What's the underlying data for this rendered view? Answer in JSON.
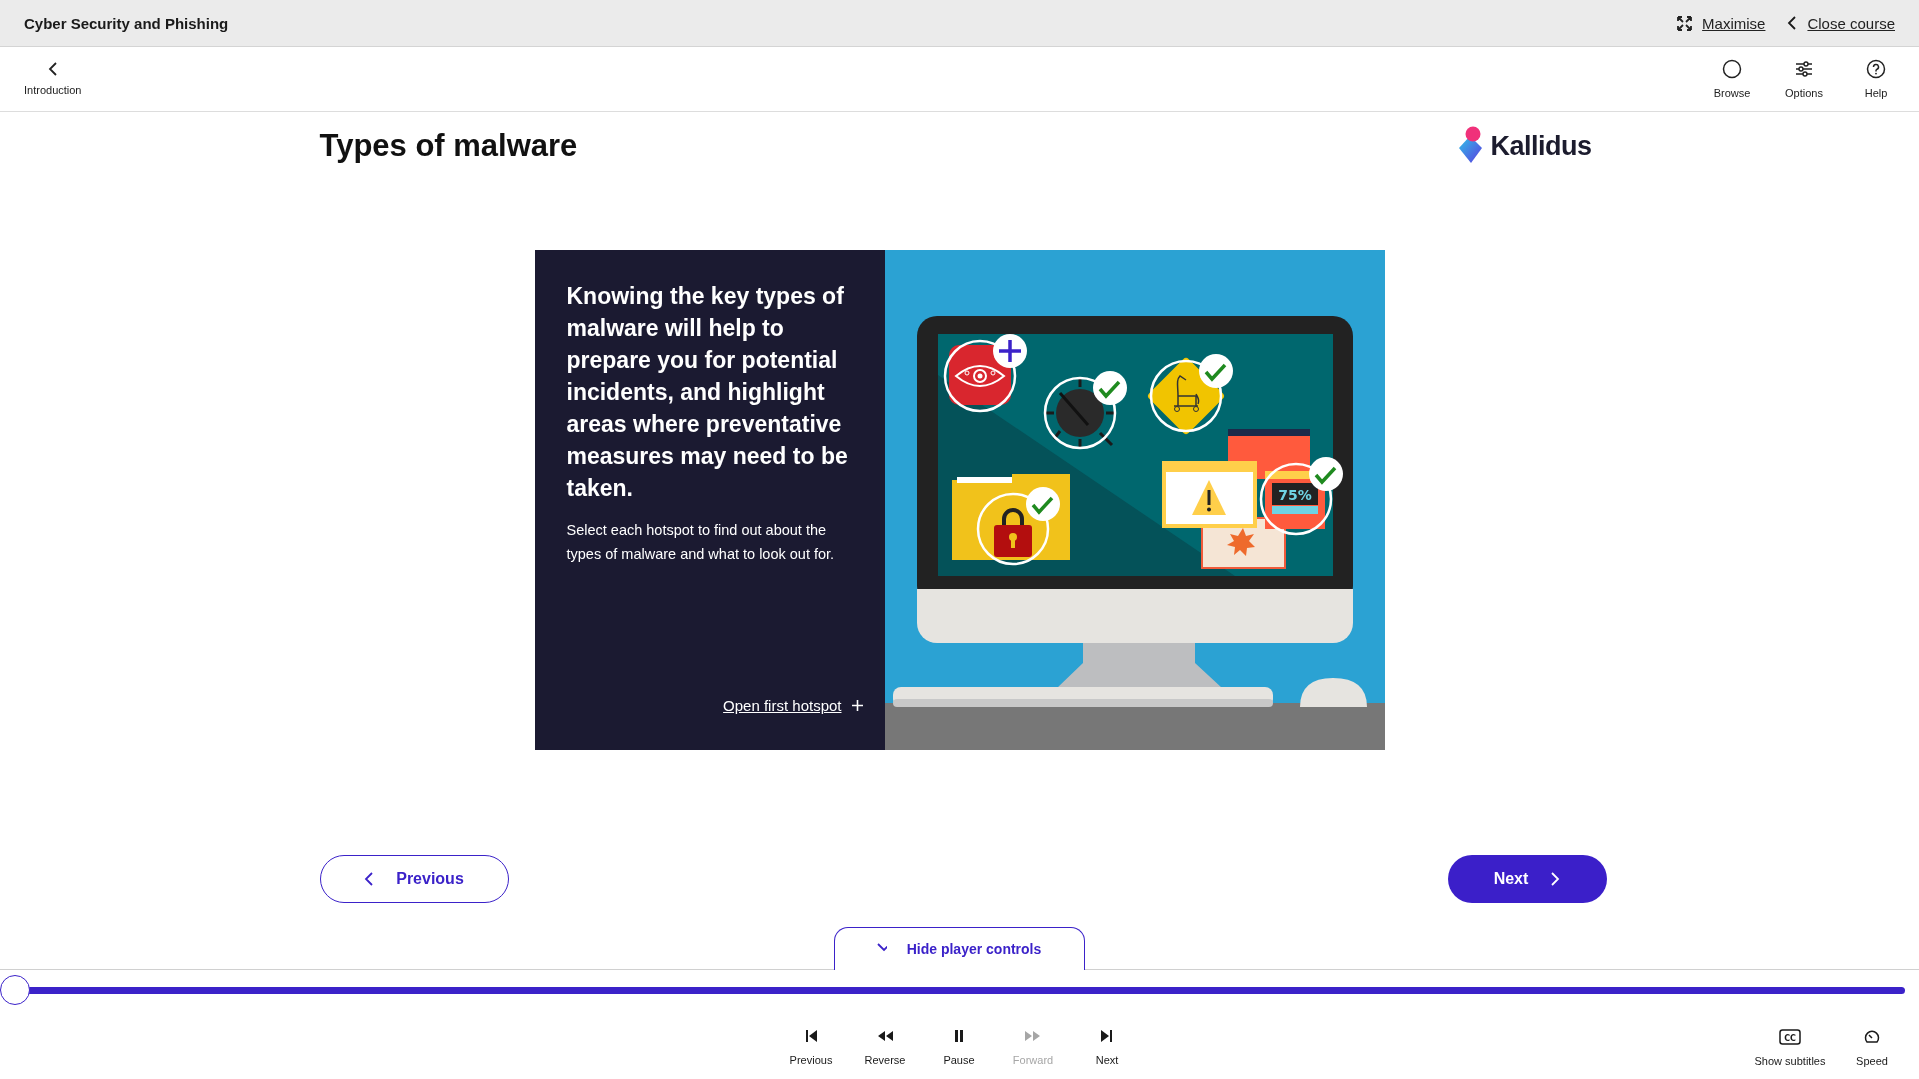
{
  "course_bar": {
    "title": "Cyber Security and Phishing",
    "links": [
      {
        "label": "Maximise"
      },
      {
        "label": "Close course"
      }
    ]
  },
  "nav_bar": {
    "back": {
      "label": "Introduction"
    },
    "tools": [
      {
        "label": "Browse"
      },
      {
        "label": "Options"
      },
      {
        "label": "Help"
      }
    ]
  },
  "slide": {
    "title": "Types of malware",
    "logo": "Kallidus",
    "panel": {
      "heading": "Knowing the key types of malware will help to prepare you for potential incidents, and highlight areas where preventative measures may need to be taken.",
      "body": "Select each hotspot to find out about the types of malware and what to look out for.",
      "link": "Open first hotspot"
    },
    "illustration": {
      "hotspots": [
        {
          "visited": false
        },
        {
          "visited": true
        },
        {
          "visited": true
        },
        {
          "visited": true
        },
        {
          "visited": true,
          "text": "75%"
        }
      ]
    }
  },
  "navigation": {
    "previous": "Previous",
    "next": "Next"
  },
  "player": {
    "toggle": "Hide player controls",
    "progress": {
      "level": 0
    },
    "controls": [
      {
        "label": "Previous",
        "disabled": false
      },
      {
        "label": "Reverse",
        "disabled": false
      },
      {
        "label": "Pause",
        "disabled": false
      },
      {
        "label": "Forward",
        "disabled": true
      },
      {
        "label": "Next",
        "disabled": false
      }
    ],
    "extras": [
      {
        "label": "Show subtitles",
        "icon_text": "CC"
      },
      {
        "label": "Speed"
      }
    ]
  }
}
